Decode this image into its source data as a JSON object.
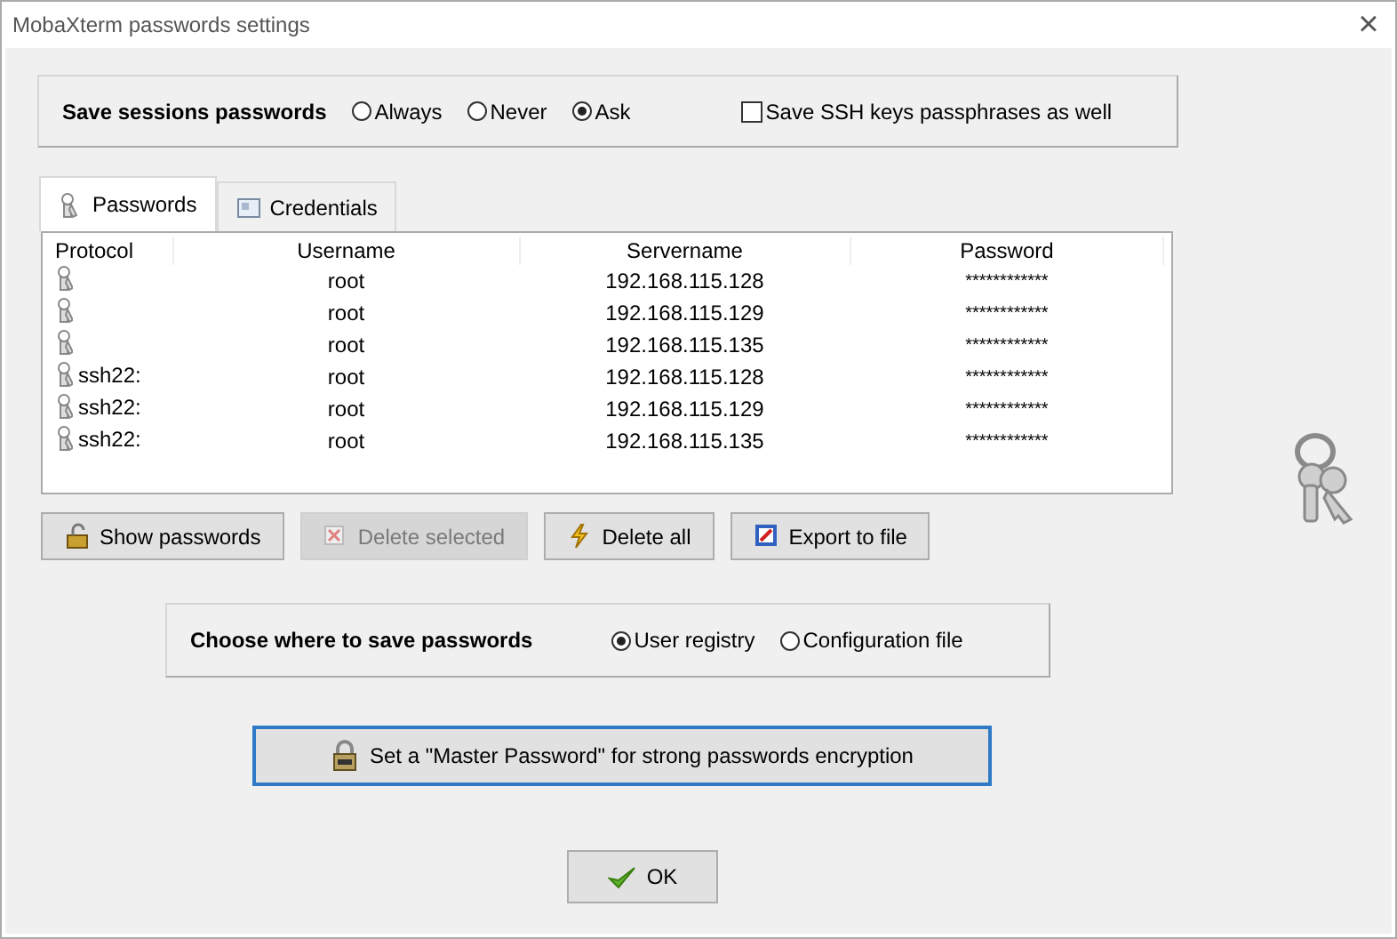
{
  "window": {
    "title": "MobaXterm passwords settings",
    "close": "×"
  },
  "save_sessions": {
    "label": "Save sessions passwords",
    "options": [
      {
        "label": "Always",
        "selected": false
      },
      {
        "label": "Never",
        "selected": false
      },
      {
        "label": "Ask",
        "selected": true
      }
    ],
    "ssh_keys": {
      "label": "Save SSH keys passphrases as well",
      "checked": false
    }
  },
  "tabs": [
    {
      "label": "Passwords",
      "selected": true
    },
    {
      "label": "Credentials",
      "selected": false
    }
  ],
  "table": {
    "columns": [
      "Protocol",
      "Username",
      "Servername",
      "Password"
    ],
    "rows": [
      {
        "protocol": "",
        "username": "root",
        "servername": "192.168.115.128",
        "password": "************"
      },
      {
        "protocol": "",
        "username": "root",
        "servername": "192.168.115.129",
        "password": "************"
      },
      {
        "protocol": "",
        "username": "root",
        "servername": "192.168.115.135",
        "password": "************"
      },
      {
        "protocol": "ssh22:",
        "username": "root",
        "servername": "192.168.115.128",
        "password": "************"
      },
      {
        "protocol": "ssh22:",
        "username": "root",
        "servername": "192.168.115.129",
        "password": "************"
      },
      {
        "protocol": "ssh22:",
        "username": "root",
        "servername": "192.168.115.135",
        "password": "************"
      }
    ]
  },
  "actions": [
    {
      "kind": "show",
      "label": "Show passwords",
      "disabled": false
    },
    {
      "kind": "delete",
      "label": "Delete selected",
      "disabled": true
    },
    {
      "kind": "deleteall",
      "label": "Delete all",
      "disabled": false
    },
    {
      "kind": "export",
      "label": "Export to file",
      "disabled": false
    }
  ],
  "storage": {
    "label": "Choose where to save passwords",
    "options": [
      {
        "label": "User registry",
        "selected": true
      },
      {
        "label": "Configuration file",
        "selected": false
      }
    ]
  },
  "master_button": "Set a \"Master Password\" for strong passwords encryption",
  "ok_button": "OK"
}
